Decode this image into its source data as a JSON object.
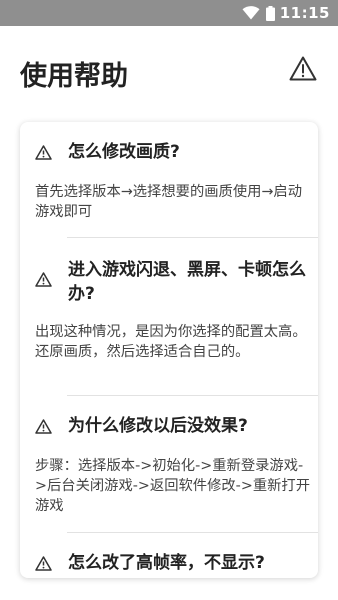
{
  "status_bar": {
    "time": "11:15",
    "wifi_icon": "wifi-icon",
    "battery_icon": "battery-icon",
    "background": "#8f8f8f"
  },
  "header": {
    "title": "使用帮助",
    "warning_icon": "warning-triangle-icon"
  },
  "faq": [
    {
      "question": "怎么修改画质?",
      "answer": "首先选择版本→选择想要的画质使用→启动游戏即可"
    },
    {
      "question": "进入游戏闪退、黑屏、卡顿怎么办?",
      "answer": "出现这种情况，是因为你选择的配置太高。还原画质，然后选择适合自己的。"
    },
    {
      "question": "为什么修改以后没效果?",
      "answer": "步骤：选择版本->初始化->重新登录游戏->后台关闭游戏->返回软件修改->重新打开游戏"
    },
    {
      "question": "怎么改了高帧率，不显示?",
      "answer": ""
    }
  ]
}
